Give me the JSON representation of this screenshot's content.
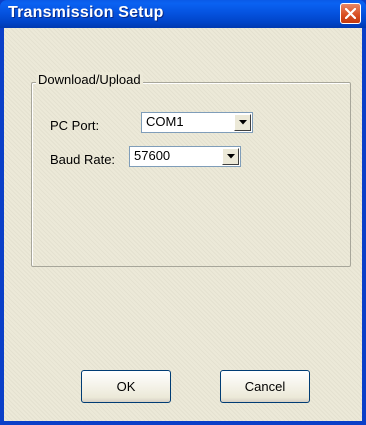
{
  "window": {
    "title": "Transmission Setup"
  },
  "group": {
    "legend": "Download/Upload",
    "pc_port": {
      "label": "PC Port:",
      "value": "COM1"
    },
    "baud_rate": {
      "label": "Baud Rate:",
      "value": "57600"
    }
  },
  "buttons": {
    "ok": "OK",
    "cancel": "Cancel"
  },
  "icons": {
    "close": "close-icon",
    "dropdown": "chevron-down-icon"
  },
  "colors": {
    "titlebar": "#0553e0",
    "close": "#d84c1e",
    "face": "#ece9d8"
  }
}
